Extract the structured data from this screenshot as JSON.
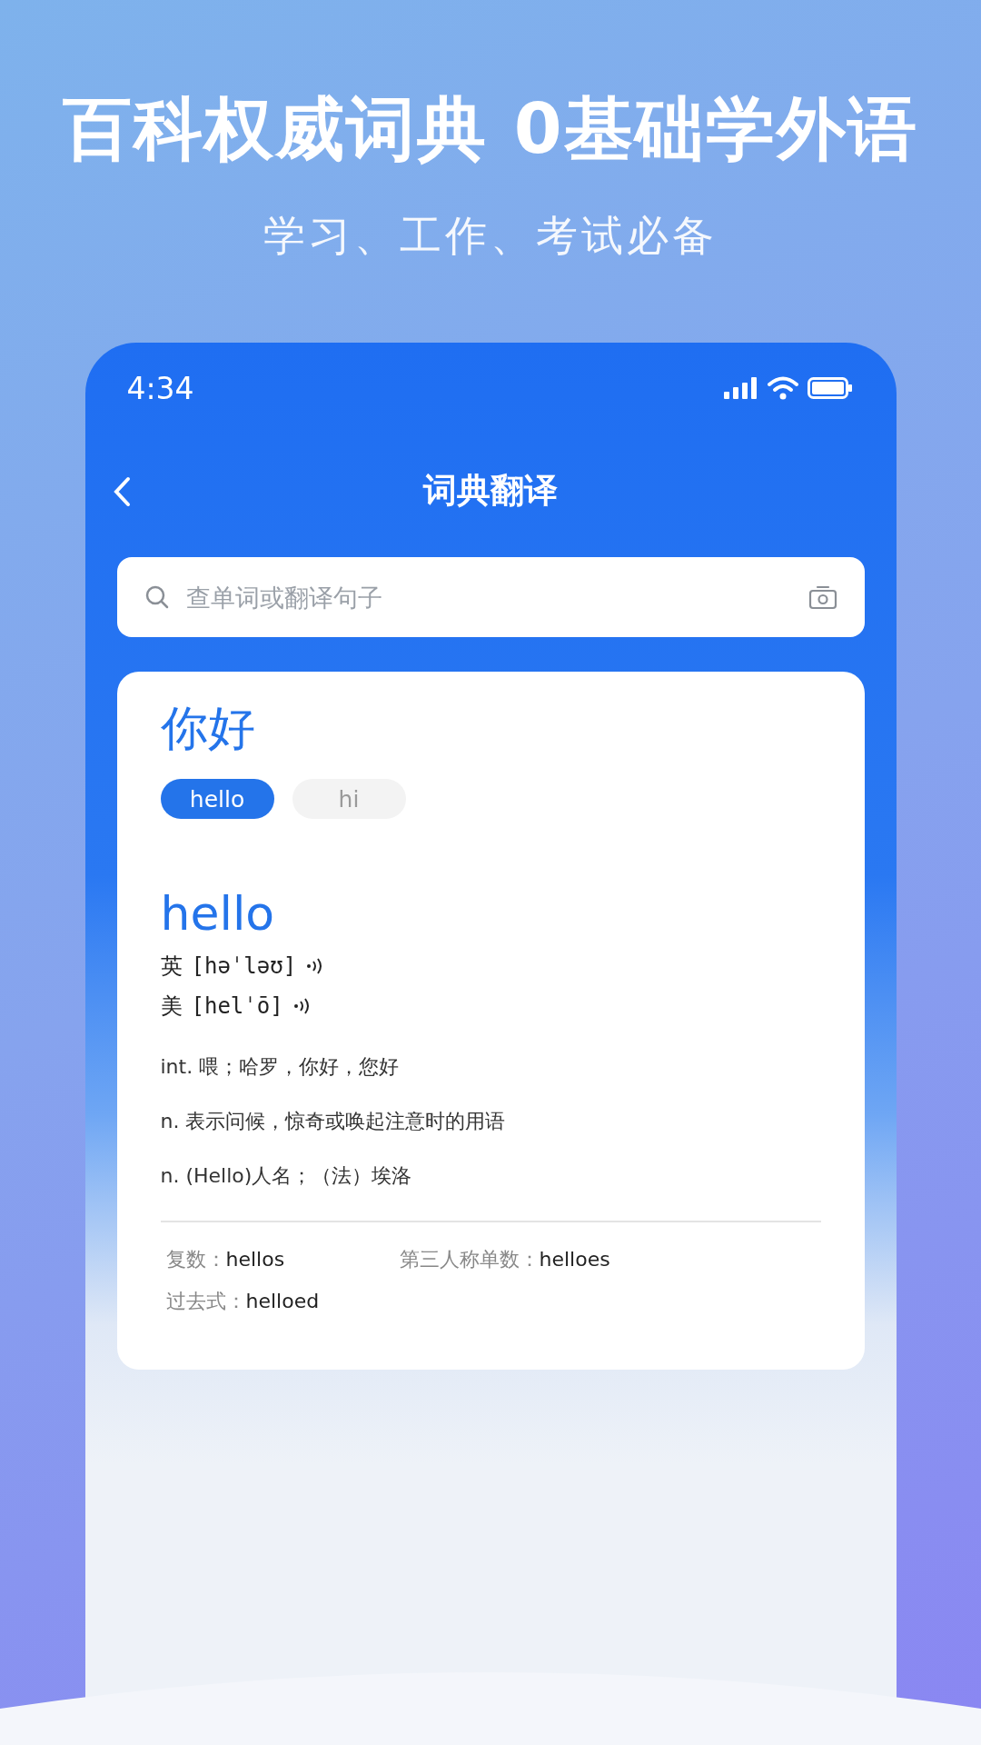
{
  "headline": "百科权威词典 0基础学外语",
  "subheadline": "学习、工作、考试必备",
  "status_bar": {
    "time": "4:34"
  },
  "nav": {
    "title": "词典翻译"
  },
  "search": {
    "placeholder": "查单词或翻译句子"
  },
  "query": {
    "word": "你好",
    "chips": [
      {
        "label": "hello",
        "selected": true
      },
      {
        "label": "hi",
        "selected": false
      }
    ]
  },
  "entry": {
    "headword": "hello",
    "pronunciations": [
      {
        "region": "英",
        "ipa": "[həˈləʊ]"
      },
      {
        "region": "美",
        "ipa": "[helˈō]"
      }
    ],
    "definitions": [
      "int. 喂；哈罗，你好，您好",
      "n. 表示问候，惊奇或唤起注意时的用语",
      "n. (Hello)人名；（法）埃洛"
    ],
    "forms": [
      {
        "label": "复数：",
        "value": "hellos"
      },
      {
        "label": "第三人称单数：",
        "value": "helloes"
      },
      {
        "label": "过去式：",
        "value": "helloed"
      }
    ]
  }
}
